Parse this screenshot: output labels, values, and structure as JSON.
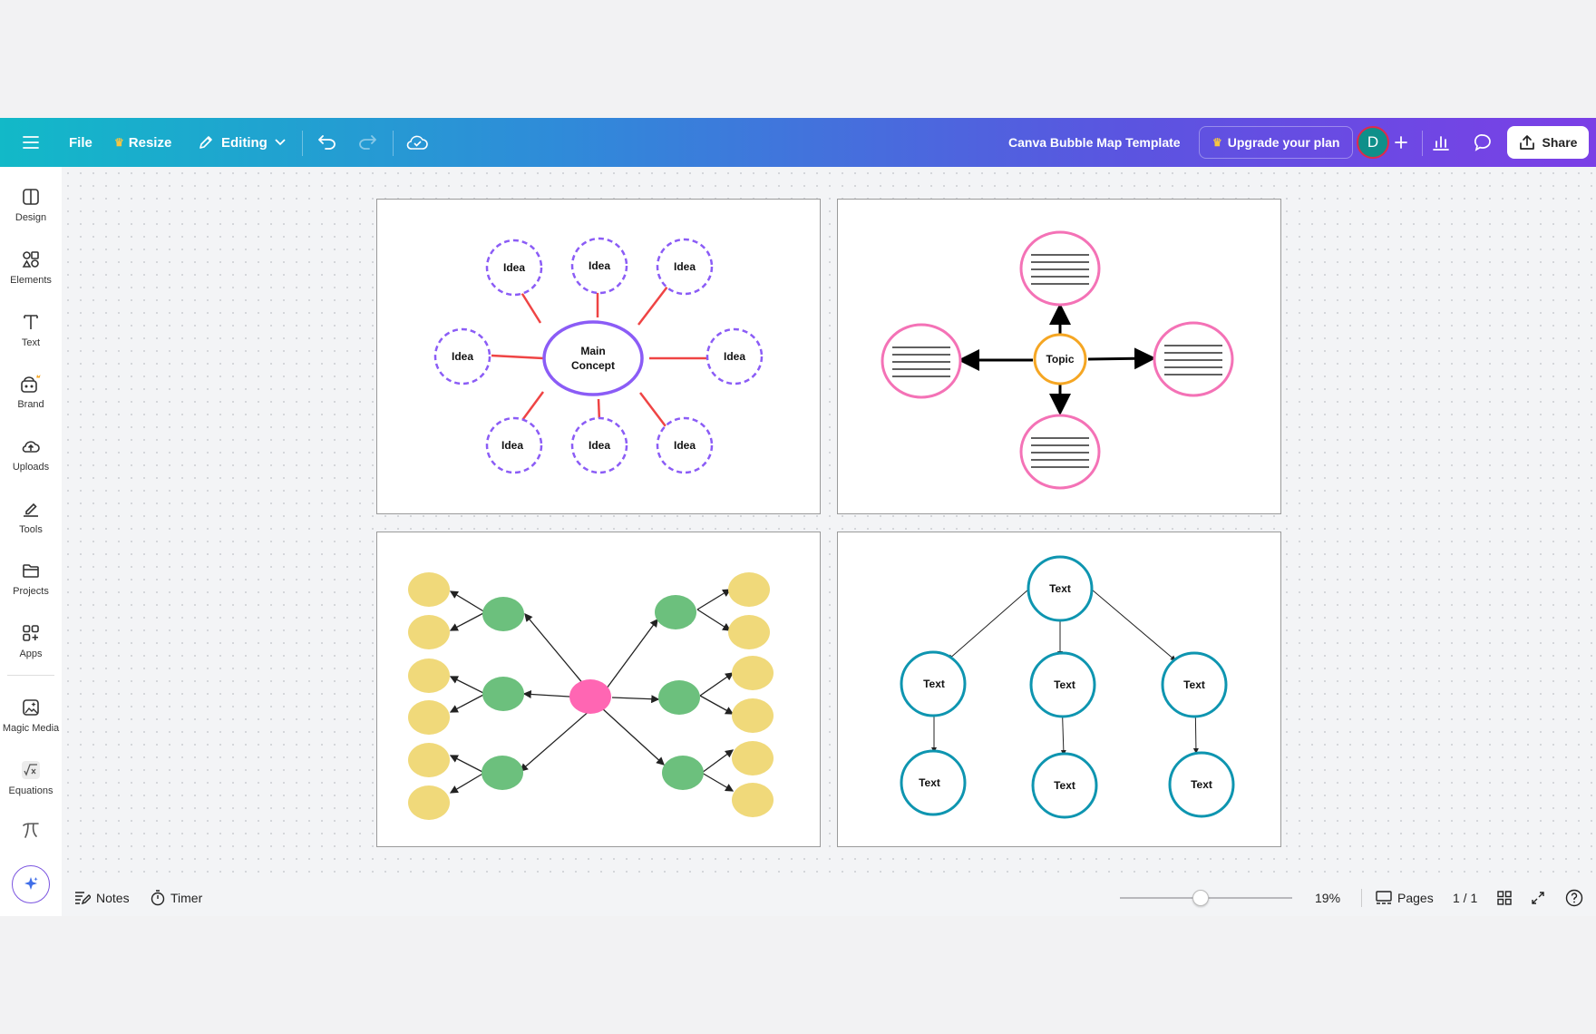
{
  "toolbar": {
    "file_label": "File",
    "resize_label": "Resize",
    "editing_label": "Editing",
    "doc_title": "Canva Bubble Map Template",
    "upgrade_label": "Upgrade your plan",
    "avatar_initial": "D",
    "share_label": "Share"
  },
  "sidebar": {
    "items": [
      {
        "label": "Design",
        "icon": "design-icon"
      },
      {
        "label": "Elements",
        "icon": "elements-icon"
      },
      {
        "label": "Text",
        "icon": "text-icon"
      },
      {
        "label": "Brand",
        "icon": "brand-icon"
      },
      {
        "label": "Uploads",
        "icon": "uploads-icon"
      },
      {
        "label": "Tools",
        "icon": "tools-icon"
      },
      {
        "label": "Projects",
        "icon": "projects-icon"
      },
      {
        "label": "Apps",
        "icon": "apps-icon"
      },
      {
        "label": "Magic Media",
        "icon": "magic-media-icon"
      },
      {
        "label": "Equations",
        "icon": "equations-icon"
      }
    ]
  },
  "pages": {
    "page1": {
      "center_line1": "Main",
      "center_line2": "Concept",
      "bubble_label": "Idea"
    },
    "page2": {
      "center_label": "Topic"
    },
    "page4": {
      "node_label": "Text"
    }
  },
  "bottombar": {
    "notes_label": "Notes",
    "timer_label": "Timer",
    "zoom_value": "19%",
    "zoom_level": 0.19,
    "pages_label": "Pages",
    "page_count": "1 / 1"
  },
  "colors": {
    "purple_bubble": "#8b5cf6",
    "red_line": "#ef4444",
    "pink_bubble": "#f472b6",
    "orange_topic": "#f5a623",
    "green_bubble": "#6cc07d",
    "yellow_bubble": "#f0d97a",
    "teal_node": "#0e95b0"
  }
}
